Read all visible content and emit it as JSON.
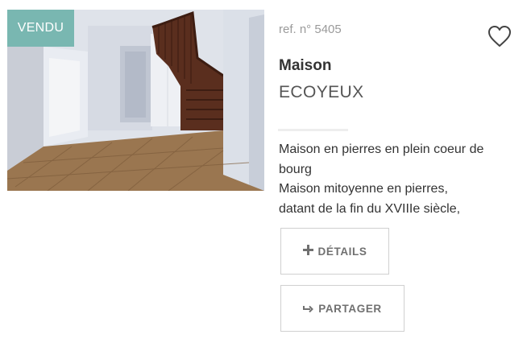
{
  "listing": {
    "status_badge": "VENDU",
    "reference": "ref. n° 5405",
    "type": "Maison",
    "city": "ECOYEUX",
    "description_lines": [
      "Maison en pierres en plein coeur de",
      "bourg",
      "Maison mitoyenne en pierres,",
      "datant de la fin du XVIIIe siècle,"
    ]
  },
  "actions": {
    "details_label": "DÉTAILS",
    "details_icon": "plus-icon",
    "share_label": "PARTAGER",
    "share_icon": "share-arrow-icon",
    "favorite_icon": "heart-icon"
  },
  "colors": {
    "badge_bg": "#79b7b1",
    "text_dark": "#333333",
    "text_muted": "#9a9a9a",
    "button_text": "#707070"
  }
}
